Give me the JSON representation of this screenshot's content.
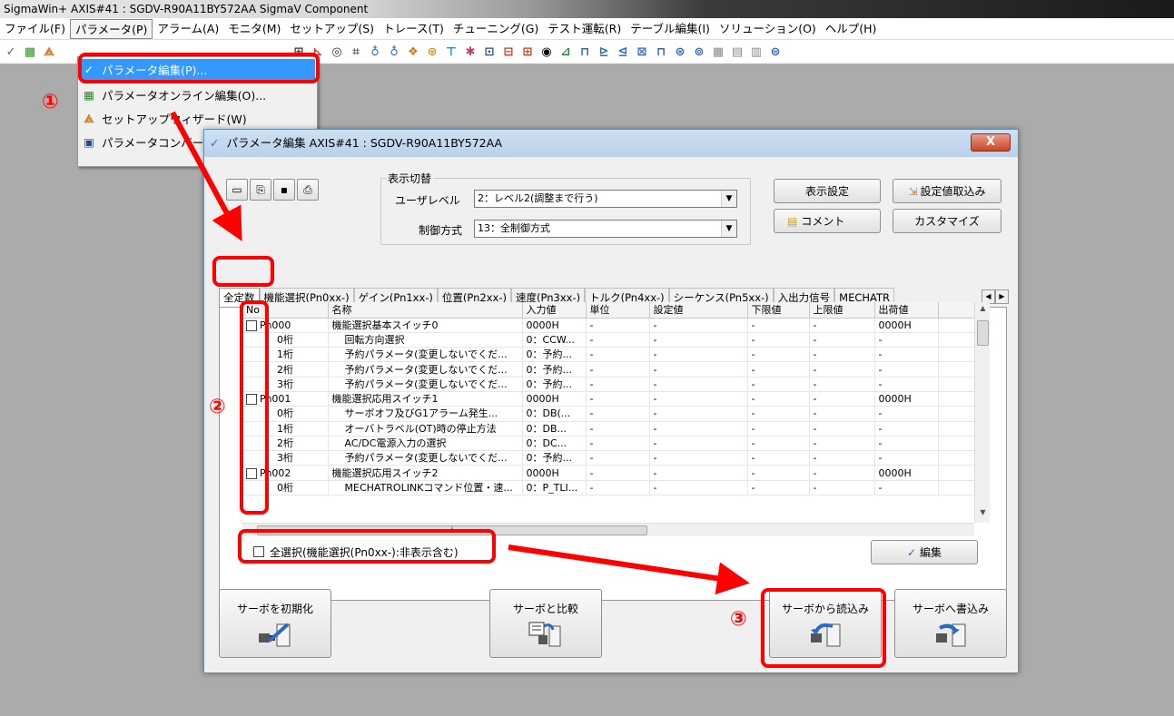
{
  "window": {
    "title": "SigmaWin+ AXIS#41 : SGDV-R90A11BY572AA SigmaV Component"
  },
  "menu": [
    "ファイル(F)",
    "パラメータ(P)",
    "アラーム(A)",
    "モニタ(M)",
    "セットアップ(S)",
    "トレース(T)",
    "チューニング(G)",
    "テスト運転(R)",
    "テーブル編集(I)",
    "ソリューション(O)",
    "ヘルプ(H)"
  ],
  "dropdown": {
    "items": [
      {
        "label": "パラメータ編集(P)...",
        "icon": "check-icon"
      },
      {
        "label": "パラメータオンライン編集(O)...",
        "icon": "online-edit-icon"
      },
      {
        "label": "セットアップウィザード(W)",
        "icon": "wizard-icon"
      },
      {
        "label": "パラメータコンバータ",
        "icon": "converter-icon"
      }
    ]
  },
  "dialog": {
    "title": "パラメータ編集 AXIS#41 : SGDV-R90A11BY572AA",
    "close_label": "X",
    "display_group": {
      "legend": "表示切替",
      "user_level_label": "ユーザレベル",
      "user_level_value": "2：レベル2(調整まで行う)",
      "control_mode_label": "制御方式",
      "control_mode_value": "13：全制御方式"
    },
    "buttons": {
      "display_settings": "表示設定",
      "import_settings": "設定値取込み",
      "comment": "コメント",
      "customize": "カスタマイズ",
      "edit": "編集",
      "initialize_servo": "サーボを初期化",
      "compare_servo": "サーボと比較",
      "read_from_servo": "サーボから読込み",
      "write_to_servo": "サーボへ書込み"
    },
    "tabs": [
      "全定数",
      "機能選択(Pn0xx-)",
      "ゲイン(Pn1xx-)",
      "位置(Pn2xx-)",
      "速度(Pn3xx-)",
      "トルク(Pn4xx-)",
      "シーケンス(Pn5xx-)",
      "入出力信号",
      "MECHATR"
    ],
    "table": {
      "columns": [
        "No",
        "名称",
        "入力値",
        "単位",
        "設定値",
        "下限値",
        "上限値",
        "出荷値"
      ],
      "rows": [
        {
          "no": "Pn000",
          "name": "機能選択基本スイッチ0",
          "input": "0000H",
          "unit": "-",
          "setting": "-",
          "min": "-",
          "max": "-",
          "default": "0000H",
          "checkbox": true
        },
        {
          "no": "0桁",
          "name": "回転方向選択",
          "input": "0：CCW...",
          "unit": "-",
          "setting": "-",
          "min": "-",
          "max": "-",
          "default": "-"
        },
        {
          "no": "1桁",
          "name": "予約パラメータ(変更しないでくだ...",
          "input": "0：予約...",
          "unit": "-",
          "setting": "-",
          "min": "-",
          "max": "-",
          "default": "-"
        },
        {
          "no": "2桁",
          "name": "予約パラメータ(変更しないでくだ...",
          "input": "0：予約...",
          "unit": "-",
          "setting": "-",
          "min": "-",
          "max": "-",
          "default": "-"
        },
        {
          "no": "3桁",
          "name": "予約パラメータ(変更しないでくだ...",
          "input": "0：予約...",
          "unit": "-",
          "setting": "-",
          "min": "-",
          "max": "-",
          "default": "-"
        },
        {
          "no": "Pn001",
          "name": "機能選択応用スイッチ1",
          "input": "0000H",
          "unit": "-",
          "setting": "-",
          "min": "-",
          "max": "-",
          "default": "0000H",
          "checkbox": true
        },
        {
          "no": "0桁",
          "name": "サーボオフ及びG1アラーム発生...",
          "input": "0：DB(...",
          "unit": "-",
          "setting": "-",
          "min": "-",
          "max": "-",
          "default": "-"
        },
        {
          "no": "1桁",
          "name": "オーバトラベル(OT)時の停止方法",
          "input": "0：DB...",
          "unit": "-",
          "setting": "-",
          "min": "-",
          "max": "-",
          "default": "-"
        },
        {
          "no": "2桁",
          "name": "AC/DC電源入力の選択",
          "input": "0：DC...",
          "unit": "-",
          "setting": "-",
          "min": "-",
          "max": "-",
          "default": "-"
        },
        {
          "no": "3桁",
          "name": "予約パラメータ(変更しないでくだ...",
          "input": "0：予約...",
          "unit": "-",
          "setting": "-",
          "min": "-",
          "max": "-",
          "default": "-"
        },
        {
          "no": "Pn002",
          "name": "機能選択応用スイッチ2",
          "input": "0000H",
          "unit": "-",
          "setting": "-",
          "min": "-",
          "max": "-",
          "default": "0000H",
          "checkbox": true
        },
        {
          "no": "0桁",
          "name": "MECHATROLINKコマンド位置・速...",
          "input": "0：P_TLI...",
          "unit": "-",
          "setting": "-",
          "min": "-",
          "max": "-",
          "default": "-"
        }
      ]
    },
    "select_all_label": "全選択(機能選択(Pn0xx-):非表示含む)"
  },
  "annotations": [
    "①",
    "②",
    "③"
  ],
  "colors": {
    "annotation": "#ff0000",
    "menu_highlight": "#3399ff",
    "workspace": "#ababab"
  }
}
